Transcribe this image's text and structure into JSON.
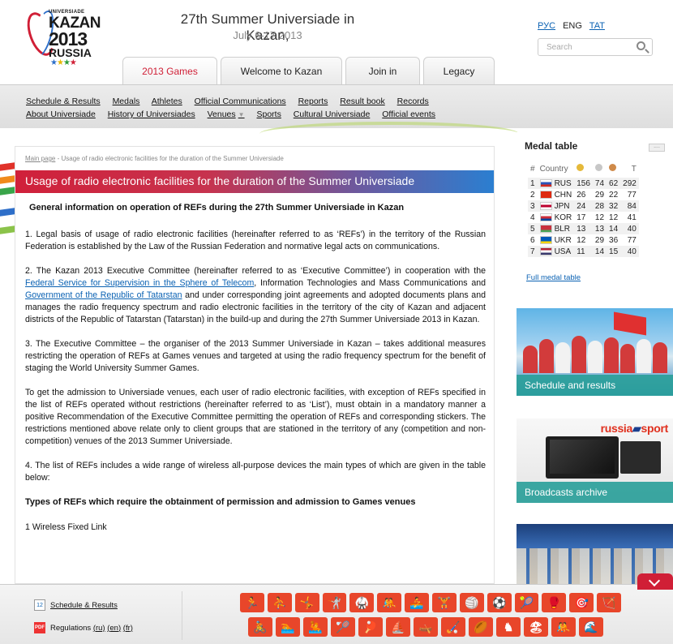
{
  "header": {
    "logo": {
      "line1": "UNIVERSIADE",
      "line2": "KAZAN",
      "line3": "2013",
      "line4": "RUSSIA"
    },
    "title": "27th Summer Universiade in Kazan,",
    "dates": "July 6-17 2013",
    "languages": [
      {
        "label": "РУС",
        "active": false
      },
      {
        "label": "ENG",
        "active": true
      },
      {
        "label": "TAT",
        "active": false
      }
    ],
    "search_placeholder": "Search"
  },
  "tabs": [
    {
      "label": "2013 Games",
      "active": true
    },
    {
      "label": "Welcome to Kazan",
      "active": false
    },
    {
      "label": "Join in",
      "active": false
    },
    {
      "label": "Legacy",
      "active": false
    }
  ],
  "nav": {
    "row1": [
      "Schedule & Results",
      "Medals",
      "Athletes",
      "Official Communications",
      "Reports",
      "Result book",
      "Records"
    ],
    "row2": [
      "About Universiade",
      "History of Universiades",
      "Venues",
      "Sports",
      "Cultural Universiade",
      "Official events"
    ]
  },
  "breadcrumb": {
    "home": "Main page",
    "current": " - Usage of radio electronic facilities for the duration of the Summer Universiade"
  },
  "article": {
    "title": "Usage of radio electronic facilities for the duration of the Summer Universiade",
    "subheading": "General information on operation of REFs during the 27th Summer Universiade in Kazan",
    "p1": "1. Legal basis of usage of radio electronic facilities (hereinafter referred to as ‘REFs’) in the territory of the Russian Federation is established by the Law of the Russian Federation and normative legal acts on communications.",
    "p2_a": "2. The Kazan 2013 Executive Committee (hereinafter referred to as ‘Executive Committee’) in cooperation with the ",
    "p2_link1": "Federal Service for Supervision in the Sphere of Telecom",
    "p2_b": ", Information Technologies and Mass Communications and ",
    "p2_link2": "Government of the Republic of Tatarstan",
    "p2_c": " and under corresponding joint agreements and adopted documents plans and manages the radio frequency spectrum and radio electronic facilities in the territory of the city of Kazan and adjacent districts of the Republic of Tatarstan (Tatarstan) in the build-up and during the 27th Summer Universiade 2013 in Kazan.",
    "p3": "3. The Executive Committee – the organiser of the 2013 Summer Universiade in Kazan – takes additional measures restricting the operation of REFs at Games venues and targeted at using the radio frequency spectrum for the benefit of staging the World University Summer Games.",
    "p4": "To get the admission to Universiade venues, each user of radio electronic facilities, with exception of REFs specified in the list of REFs operated without restrictions (hereinafter referred to as ‘List’), must obtain in a mandatory manner a positive Recommendation of the Executive Committee permitting the operation of REFs and corresponding stickers. The restrictions mentioned above relate only to client groups that are stationed in the territory of any (competition and non-competition) venues of the 2013 Summer Universiade.",
    "p5": "4. The list of REFs includes a wide range of wireless all-purpose devices the main types of which are given in the table below:",
    "subheading2": "Types of REFs which require the obtainment of permission and admission to Games venues",
    "p6": "1 Wireless Fixed Link"
  },
  "medal_table": {
    "title": "Medal table",
    "more_label": "....",
    "headers": {
      "rank": "#",
      "country": "Country",
      "total": "T"
    },
    "medal_colors": {
      "gold": "#e5b93a",
      "silver": "#c7c7c7",
      "bronze": "#cf8a4a"
    },
    "rows": [
      {
        "rank": "1",
        "code": "RUS",
        "gold": "156",
        "silver": "74",
        "bronze": "62",
        "total": "292",
        "flag": [
          "#ffffff",
          "#2a55b8",
          "#d52b1e"
        ]
      },
      {
        "rank": "2",
        "code": "CHN",
        "gold": "26",
        "silver": "29",
        "bronze": "22",
        "total": "77",
        "flag": [
          "#de2910",
          "#de2910",
          "#de2910"
        ]
      },
      {
        "rank": "3",
        "code": "JPN",
        "gold": "24",
        "silver": "28",
        "bronze": "32",
        "total": "84",
        "flag": [
          "#ffffff",
          "#bc002d",
          "#ffffff"
        ]
      },
      {
        "rank": "4",
        "code": "KOR",
        "gold": "17",
        "silver": "12",
        "bronze": "12",
        "total": "41",
        "flag": [
          "#ffffff",
          "#cd2e3a",
          "#0047a0"
        ]
      },
      {
        "rank": "5",
        "code": "BLR",
        "gold": "13",
        "silver": "13",
        "bronze": "14",
        "total": "40",
        "flag": [
          "#c8313e",
          "#c8313e",
          "#4aa657"
        ]
      },
      {
        "rank": "6",
        "code": "UKR",
        "gold": "12",
        "silver": "29",
        "bronze": "36",
        "total": "77",
        "flag": [
          "#005bbb",
          "#005bbb",
          "#ffd500"
        ]
      },
      {
        "rank": "7",
        "code": "USA",
        "gold": "11",
        "silver": "14",
        "bronze": "15",
        "total": "40",
        "flag": [
          "#b22234",
          "#ffffff",
          "#3c3b6e"
        ]
      }
    ],
    "full_link": "Full medal table"
  },
  "promos": {
    "schedule": "Schedule and results",
    "russia_sport_a": "russia",
    "russia_sport_b": "sport",
    "broadcasts": "Broadcasts archive"
  },
  "footer": {
    "calendar_day": "12",
    "pdf_label": "PDF",
    "schedule_link": "Schedule & Results",
    "regulations": "Regulations",
    "reg_ru": "(ru)",
    "reg_en": "(en)",
    "reg_fr": "(fr)"
  }
}
